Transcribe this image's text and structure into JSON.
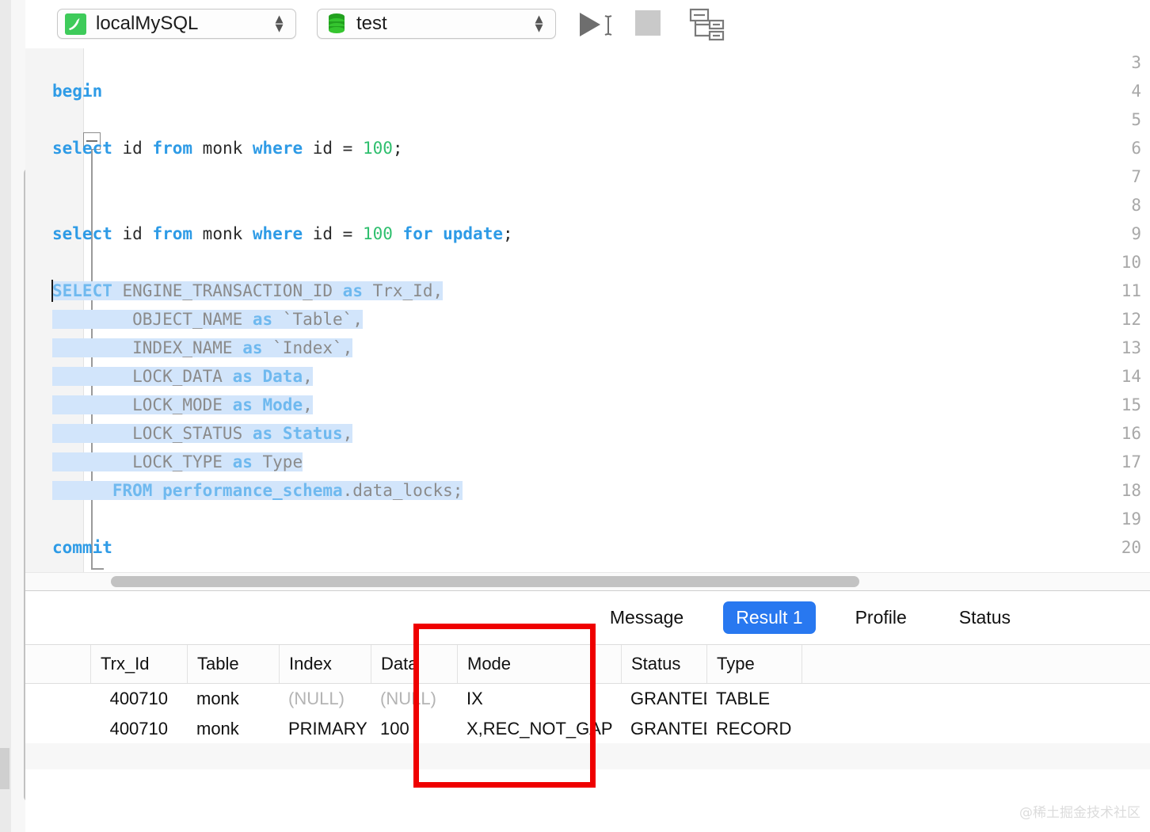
{
  "toolbar": {
    "connection": {
      "name": "localMySQL",
      "icon": "mysql-dolphin-icon"
    },
    "database": {
      "name": "test",
      "icon": "database-cylinder-icon"
    },
    "run_icon": "run-play-icon",
    "stop_icon": "stop-square-icon",
    "explain_icon": "explain-plan-icon"
  },
  "editor": {
    "lines": [
      {
        "num": "3",
        "tokens": []
      },
      {
        "num": "4",
        "tokens": [
          {
            "t": "begin",
            "c": "kw"
          }
        ]
      },
      {
        "num": "5",
        "tokens": []
      },
      {
        "num": "6",
        "tokens": [
          {
            "t": "select ",
            "c": "kw"
          },
          {
            "t": "id ",
            "c": "id"
          },
          {
            "t": "from ",
            "c": "kw"
          },
          {
            "t": "monk ",
            "c": "id"
          },
          {
            "t": "where ",
            "c": "kw"
          },
          {
            "t": "id = ",
            "c": "id"
          },
          {
            "t": "100",
            "c": "num"
          },
          {
            "t": ";",
            "c": "id"
          }
        ]
      },
      {
        "num": "7",
        "tokens": []
      },
      {
        "num": "8",
        "tokens": []
      },
      {
        "num": "9",
        "tokens": [
          {
            "t": "select ",
            "c": "kw"
          },
          {
            "t": "id ",
            "c": "id"
          },
          {
            "t": "from ",
            "c": "kw"
          },
          {
            "t": "monk ",
            "c": "id"
          },
          {
            "t": "where ",
            "c": "kw"
          },
          {
            "t": "id = ",
            "c": "id"
          },
          {
            "t": "100 ",
            "c": "num"
          },
          {
            "t": "for update",
            "c": "kw"
          },
          {
            "t": ";",
            "c": "id"
          }
        ]
      },
      {
        "num": "10",
        "tokens": []
      },
      {
        "num": "11",
        "selected": true,
        "tokens": [
          {
            "t": "SELECT ",
            "c": "kw-dim"
          },
          {
            "t": "ENGINE_TRANSACTION_ID ",
            "c": "id-dim"
          },
          {
            "t": "as ",
            "c": "kw-dim"
          },
          {
            "t": "Trx_Id,",
            "c": "id-dim"
          }
        ]
      },
      {
        "num": "12",
        "selected": true,
        "tokens": [
          {
            "t": "        OBJECT_NAME ",
            "c": "id-dim"
          },
          {
            "t": "as ",
            "c": "kw-dim"
          },
          {
            "t": "`Table`,",
            "c": "id-dim"
          }
        ]
      },
      {
        "num": "13",
        "selected": true,
        "tokens": [
          {
            "t": "        INDEX_NAME ",
            "c": "id-dim"
          },
          {
            "t": "as ",
            "c": "kw-dim"
          },
          {
            "t": "`Index`,",
            "c": "id-dim"
          }
        ]
      },
      {
        "num": "14",
        "selected": true,
        "tokens": [
          {
            "t": "        LOCK_DATA ",
            "c": "id-dim"
          },
          {
            "t": "as ",
            "c": "kw-dim"
          },
          {
            "t": "Data",
            "c": "kw-dim"
          },
          {
            "t": ",",
            "c": "id-dim"
          }
        ]
      },
      {
        "num": "15",
        "selected": true,
        "tokens": [
          {
            "t": "        LOCK_MODE ",
            "c": "id-dim"
          },
          {
            "t": "as ",
            "c": "kw-dim"
          },
          {
            "t": "Mode",
            "c": "kw-dim"
          },
          {
            "t": ",",
            "c": "id-dim"
          }
        ]
      },
      {
        "num": "16",
        "selected": true,
        "tokens": [
          {
            "t": "        LOCK_STATUS ",
            "c": "id-dim"
          },
          {
            "t": "as ",
            "c": "kw-dim"
          },
          {
            "t": "Status",
            "c": "kw-dim"
          },
          {
            "t": ",",
            "c": "id-dim"
          }
        ]
      },
      {
        "num": "17",
        "selected": true,
        "tokens": [
          {
            "t": "        LOCK_TYPE ",
            "c": "id-dim"
          },
          {
            "t": "as ",
            "c": "kw-dim"
          },
          {
            "t": "Type",
            "c": "id-dim"
          }
        ]
      },
      {
        "num": "18",
        "selected": true,
        "tokens": [
          {
            "t": "      FROM performance_schema",
            "c": "kw-dim"
          },
          {
            "t": ".data_locks;",
            "c": "id-dim"
          }
        ]
      },
      {
        "num": "19",
        "tokens": []
      },
      {
        "num": "20",
        "tokens": [
          {
            "t": "commit",
            "c": "kw"
          }
        ]
      }
    ]
  },
  "results": {
    "tabs": [
      {
        "label": "Message",
        "active": false
      },
      {
        "label": "Result 1",
        "active": true
      },
      {
        "label": "Profile",
        "active": false
      },
      {
        "label": "Status",
        "active": false
      }
    ],
    "columns": [
      "Trx_Id",
      "Table",
      "Index",
      "Data",
      "Mode",
      "Status",
      "Type"
    ],
    "rows": [
      {
        "Trx_Id": "400710",
        "Table": "monk",
        "Index": "(NULL)",
        "Data": "(NULL)",
        "Mode": "IX",
        "Status": "GRANTED",
        "Type": "TABLE"
      },
      {
        "Trx_Id": "400710",
        "Table": "monk",
        "Index": "PRIMARY",
        "Data": "100",
        "Mode": "X,REC_NOT_GAP",
        "Status": "GRANTED",
        "Type": "RECORD"
      }
    ]
  },
  "annotation": {
    "highlight_color": "#ef0000",
    "target_column": "Mode"
  },
  "watermark": {
    "text": "@稀土掘金技术社区"
  }
}
